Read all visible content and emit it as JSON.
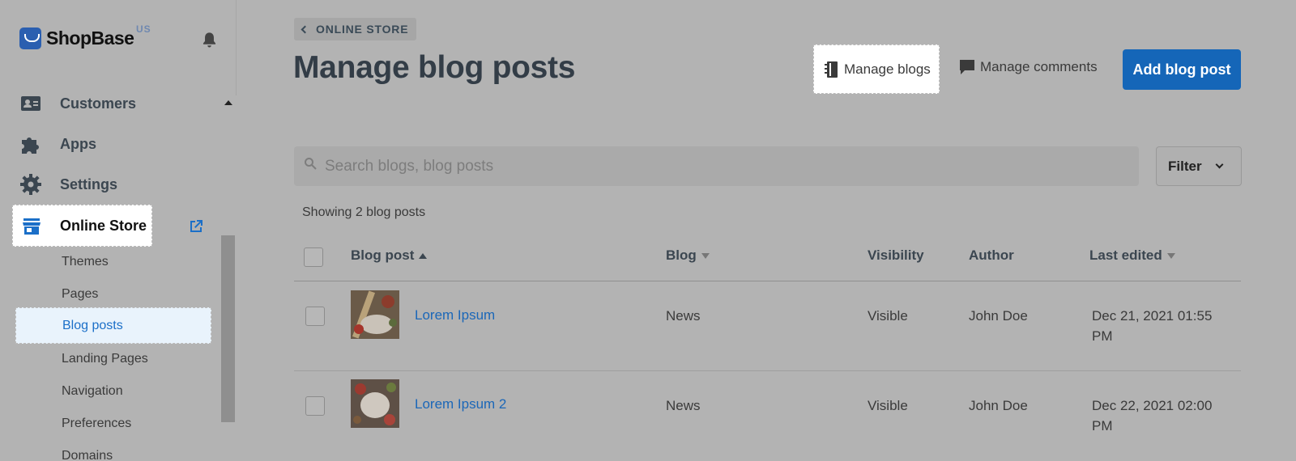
{
  "app": {
    "name": "ShopBase",
    "region": "US"
  },
  "sidebar": {
    "items": [
      {
        "label": "Customers",
        "icon": "customers-icon"
      },
      {
        "label": "Apps",
        "icon": "puzzle-icon"
      },
      {
        "label": "Settings",
        "icon": "gear-icon"
      },
      {
        "label": "Online Store",
        "icon": "store-icon"
      }
    ],
    "sub_items": [
      "Themes",
      "Pages",
      "Blog posts",
      "Landing Pages",
      "Navigation",
      "Preferences",
      "Domains"
    ],
    "active_sub_item": "Blog posts"
  },
  "header": {
    "breadcrumb": "ONLINE STORE",
    "title": "Manage blog posts",
    "manage_blogs_label": "Manage blogs",
    "manage_comments_label": "Manage comments",
    "add_label": "Add blog post"
  },
  "search": {
    "placeholder": "Search blogs, blog posts"
  },
  "filter": {
    "label": "Filter"
  },
  "showing_text": "Showing 2 blog posts",
  "table": {
    "columns": [
      "Blog post",
      "Blog",
      "Visibility",
      "Author",
      "Last edited"
    ],
    "rows": [
      {
        "title": "Lorem Ipsum",
        "blog": "News",
        "visibility": "Visible",
        "author": "John Doe",
        "last_edited_1": "Dec 21, 2021 01:55",
        "last_edited_2": "PM"
      },
      {
        "title": "Lorem Ipsum 2",
        "blog": "News",
        "visibility": "Visible",
        "author": "John Doe",
        "last_edited_1": "Dec 22, 2021 02:00",
        "last_edited_2": "PM"
      }
    ]
  },
  "colors": {
    "primary": "#1566b8",
    "link": "#1b67b8",
    "active_bg": "#e9f3fc"
  }
}
